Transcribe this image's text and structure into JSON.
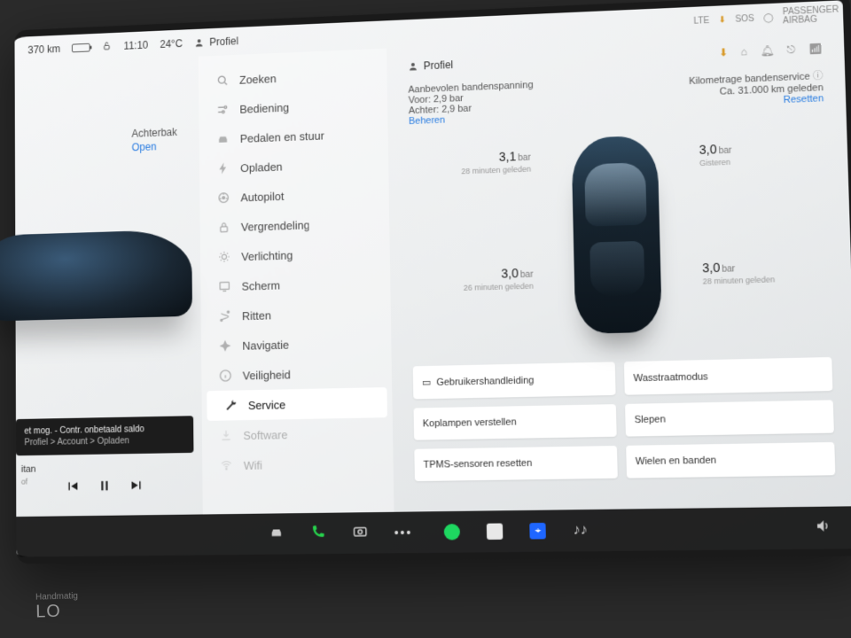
{
  "status": {
    "range": "370 km",
    "time": "11:10",
    "temperature": "24°C",
    "profile_label": "Profiel",
    "conn": "LTE",
    "airbag": "PASSENGER AIRBAG",
    "sos": "SOS"
  },
  "left": {
    "trunk_label": "Achterbak",
    "trunk_action": "Open",
    "notification_line1": "et mog. - Contr. onbetaald saldo",
    "notification_line2": "Profiel > Account > Opladen",
    "media_title": "itan",
    "media_artist": "of"
  },
  "sidebar": {
    "items": [
      "Zoeken",
      "Bediening",
      "Pedalen en stuur",
      "Opladen",
      "Autopilot",
      "Vergrendeling",
      "Verlichting",
      "Scherm",
      "Ritten",
      "Navigatie",
      "Veiligheid",
      "Service",
      "Software",
      "Wifi"
    ],
    "active_index": 11
  },
  "main": {
    "profile_label": "Profiel",
    "pressure": {
      "title": "Aanbevolen bandenspanning",
      "front": "Voor: 2,9 bar",
      "rear": "Achter: 2,9 bar",
      "manage": "Beheren"
    },
    "service": {
      "title": "Kilometrage bandenservice",
      "value": "Ca. 31.000 km geleden",
      "reset": "Resetten"
    },
    "tires": {
      "fl": {
        "value": "3,1",
        "unit": "bar",
        "sub": "28 minuten geleden"
      },
      "fr": {
        "value": "3,0",
        "unit": "bar",
        "sub": "Gisteren"
      },
      "rl": {
        "value": "3,0",
        "unit": "bar",
        "sub": "26 minuten geleden"
      },
      "rr": {
        "value": "3,0",
        "unit": "bar",
        "sub": "28 minuten geleden"
      }
    },
    "buttons": [
      "Gebruikershandleiding",
      "Wasstraatmodus",
      "Koplampen verstellen",
      "Slepen",
      "TPMS-sensoren resetten",
      "Wielen en banden"
    ]
  },
  "below": {
    "mode": "Handmatig",
    "temp": "LO"
  }
}
